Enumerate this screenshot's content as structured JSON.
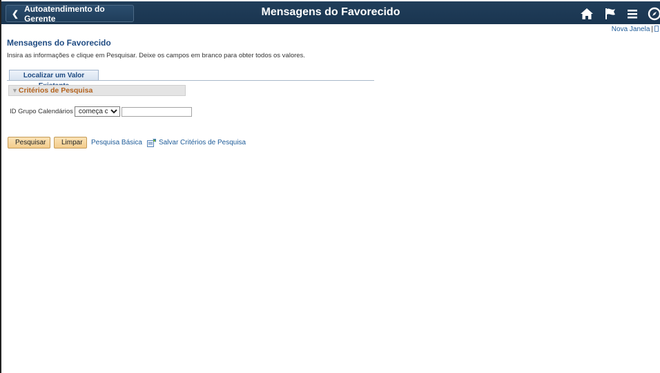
{
  "header": {
    "back_label": "Autoatendimento do Gerente",
    "title": "Mensagens do Favorecido",
    "icons": [
      "home-icon",
      "flag-icon",
      "menu-icon",
      "nav-compass-icon"
    ]
  },
  "top_links": {
    "new_window": "Nova Janela",
    "separator": "|"
  },
  "page": {
    "title": "Mensagens do Favorecido",
    "instructions": "Insira as informações e clique em Pesquisar. Deixe os campos em branco para obter todos os valores."
  },
  "tabs": [
    {
      "label": "Localizar um Valor Existente"
    }
  ],
  "criteria": {
    "header": "Critérios de Pesquisa",
    "field_label": "ID Grupo Calendários",
    "operator_selected": "começa com",
    "value": ""
  },
  "actions": {
    "search": "Pesquisar",
    "clear": "Limpar",
    "basic_search": "Pesquisa Básica",
    "save_criteria": "Salvar Critérios de Pesquisa"
  },
  "colors": {
    "banner": "#1f3d5a",
    "link": "#1d5b98",
    "criteria_text": "#b3621d",
    "button": "#f3cc8c"
  }
}
